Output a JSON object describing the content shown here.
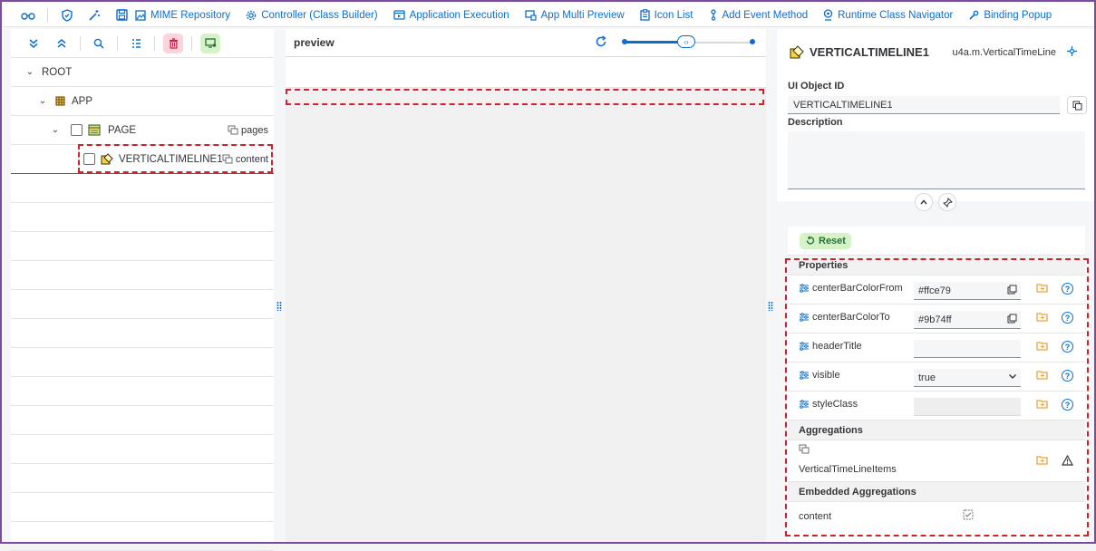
{
  "toolbar": {
    "items": [
      {
        "label": "MIME Repository"
      },
      {
        "label": "Controller (Class Builder)"
      },
      {
        "label": "Application Execution"
      },
      {
        "label": "App Multi Preview"
      },
      {
        "label": "Icon List"
      },
      {
        "label": "Add Event Method"
      },
      {
        "label": "Runtime Class Navigator"
      },
      {
        "label": "Binding Popup"
      }
    ]
  },
  "tree": {
    "root": "ROOT",
    "app": "APP",
    "page": "PAGE",
    "page_agg": "pages",
    "control": "VERTICALTIMELINE1",
    "control_agg": "content"
  },
  "preview": {
    "title": "preview"
  },
  "object": {
    "name": "VERTICALTIMELINE1",
    "class": "u4a.m.VerticalTimeLine",
    "id_label": "UI Object ID",
    "id_value": "VERTICALTIMELINE1",
    "desc_label": "Description"
  },
  "attributes": {
    "reset_label": "Reset",
    "properties_header": "Properties",
    "properties": [
      {
        "name": "centerBarColorFrom",
        "value": "#ffce79"
      },
      {
        "name": "centerBarColorTo",
        "value": "#9b74ff"
      },
      {
        "name": "headerTitle",
        "value": ""
      },
      {
        "name": "visible",
        "value": "true"
      },
      {
        "name": "styleClass",
        "value": ""
      }
    ],
    "aggregations_header": "Aggregations",
    "aggregation_name": "VerticalTimeLineItems",
    "embedded_header": "Embedded Aggregations",
    "embedded_name": "content"
  },
  "colors": {
    "accent": "#0a6ed1",
    "highlight_dash": "#d0222c",
    "frame": "#7c4a9e"
  }
}
